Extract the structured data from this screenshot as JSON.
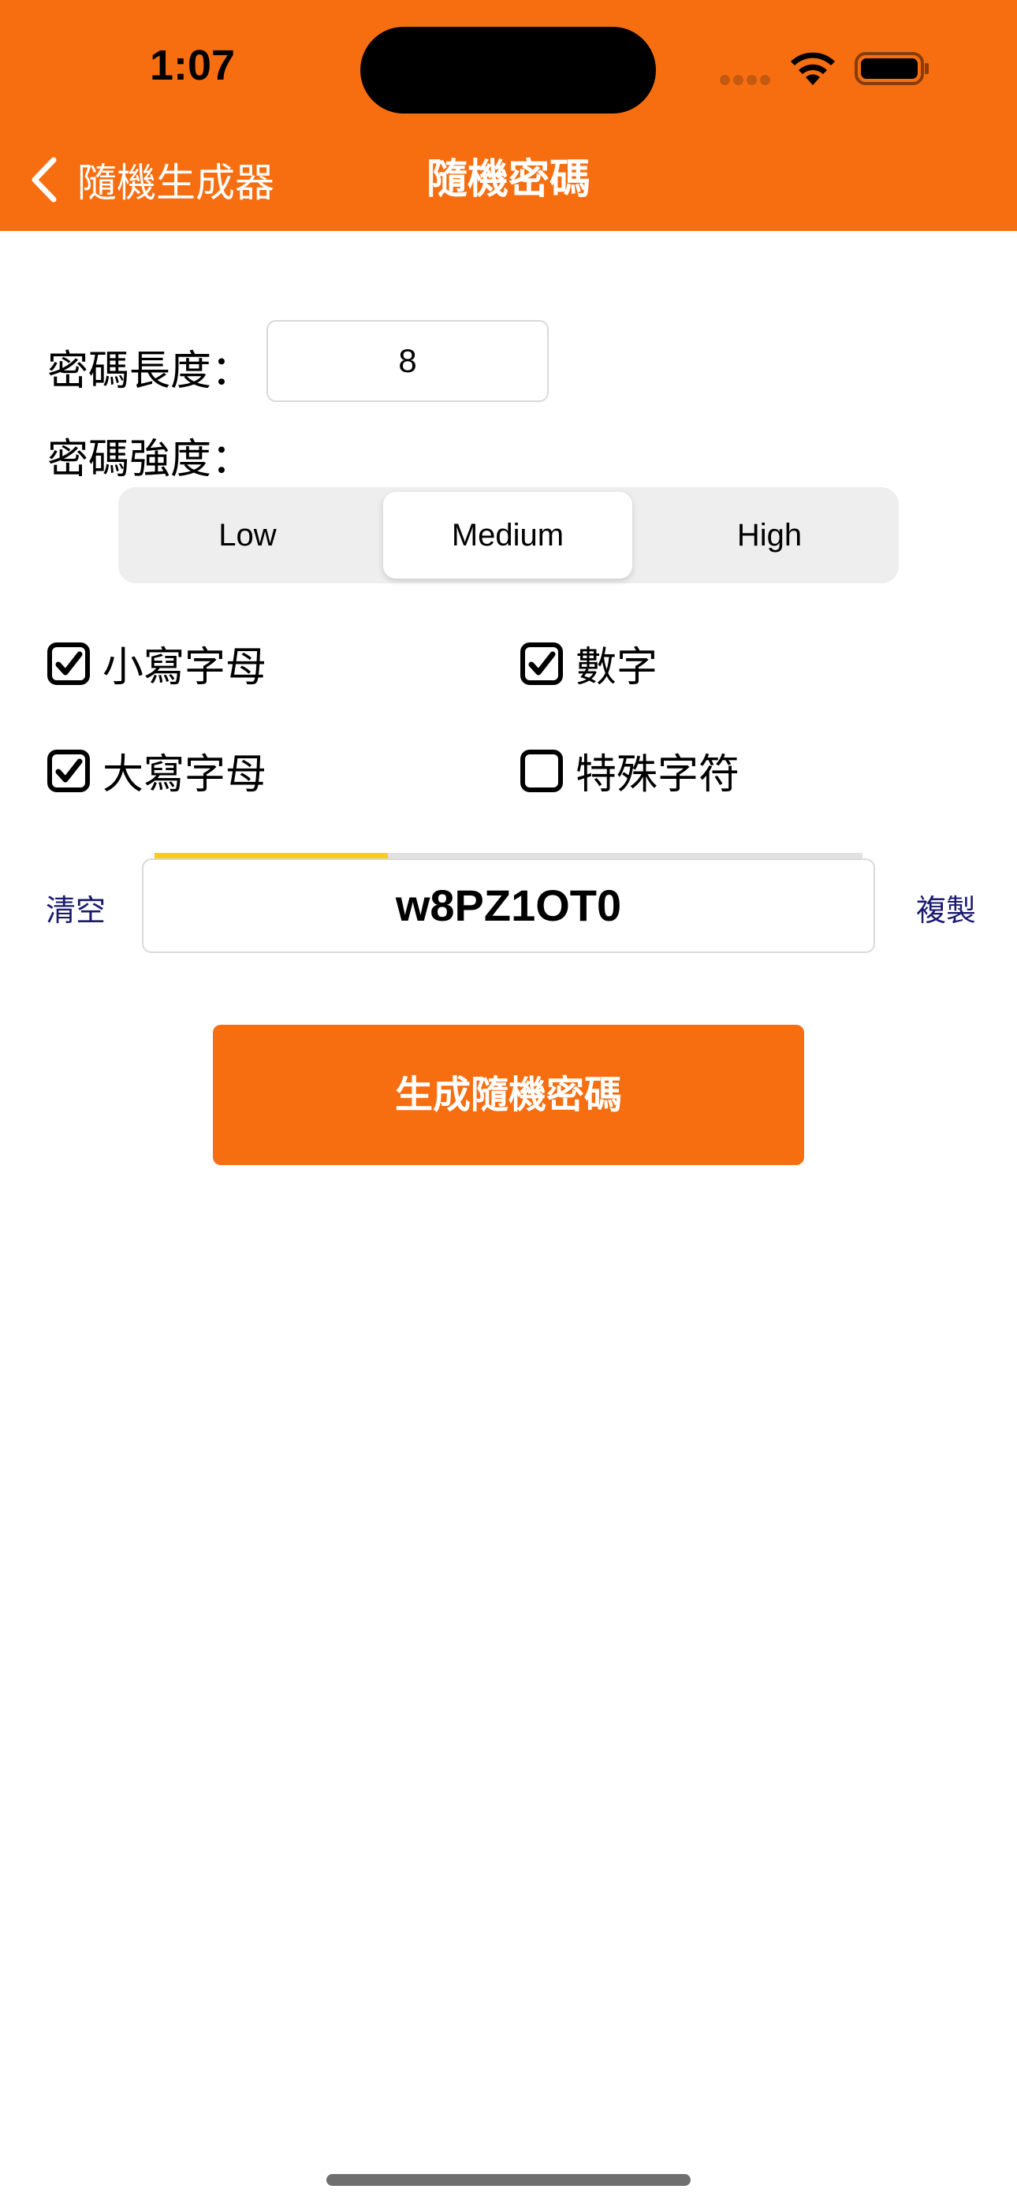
{
  "status_bar": {
    "time": "1:07"
  },
  "nav": {
    "back_label": "隨機生成器",
    "title": "隨機密碼"
  },
  "form": {
    "length_label": "密碼長度：",
    "length_value": "8",
    "strength_label": "密碼強度："
  },
  "strength_options": {
    "selected": "Medium",
    "items": [
      "Low",
      "Medium",
      "High"
    ]
  },
  "options": {
    "lowercase": {
      "label": "小寫字母",
      "checked": true
    },
    "digits": {
      "label": "數字",
      "checked": true
    },
    "uppercase": {
      "label": "大寫字母",
      "checked": true
    },
    "special": {
      "label": "特殊字符",
      "checked": false
    }
  },
  "result": {
    "clear_label": "清空",
    "password": "w8PZ1OT0",
    "copy_label": "複製",
    "strength_fraction": 0.33
  },
  "actions": {
    "generate_label": "生成隨機密碼"
  },
  "colors": {
    "accent": "#F76E11",
    "strength_bar": "#F5CE1A",
    "link": "#1a1a6e"
  }
}
